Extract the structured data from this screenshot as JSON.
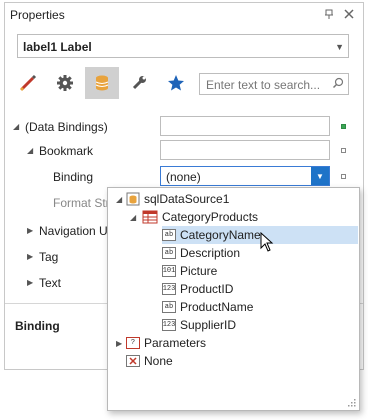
{
  "window": {
    "title": "Properties"
  },
  "selector": {
    "value": "label1   Label"
  },
  "tabs": [
    {
      "name": "appearance-tab",
      "icon": "brush-icon"
    },
    {
      "name": "behavior-tab",
      "icon": "gear-icon"
    },
    {
      "name": "data-tab",
      "icon": "database-icon",
      "active": true
    },
    {
      "name": "design-tab",
      "icon": "wrench-icon"
    },
    {
      "name": "favorites-tab",
      "icon": "star-icon"
    }
  ],
  "search": {
    "placeholder": "Enter text to search..."
  },
  "props": {
    "data_bindings": "(Data Bindings)",
    "bookmark": "Bookmark",
    "binding": "Binding",
    "binding_value": "(none)",
    "format_string": "Format Stri",
    "navigation_url": "Navigation UR",
    "tag": "Tag",
    "text": "Text"
  },
  "description": {
    "title": "Binding"
  },
  "tree": {
    "datasource": "sqlDataSource1",
    "table": "CategoryProducts",
    "fields": [
      {
        "label": "CategoryName",
        "type": "ab",
        "selected": true
      },
      {
        "label": "Description",
        "type": "ab"
      },
      {
        "label": "Picture",
        "type": "101"
      },
      {
        "label": "ProductID",
        "type": "123"
      },
      {
        "label": "ProductName",
        "type": "ab"
      },
      {
        "label": "SupplierID",
        "type": "123"
      }
    ],
    "parameters": "Parameters",
    "none": "None"
  },
  "colors": {
    "accent": "#1e73c8",
    "selection": "#cde1f5",
    "bound_marker": "#3aa655"
  }
}
